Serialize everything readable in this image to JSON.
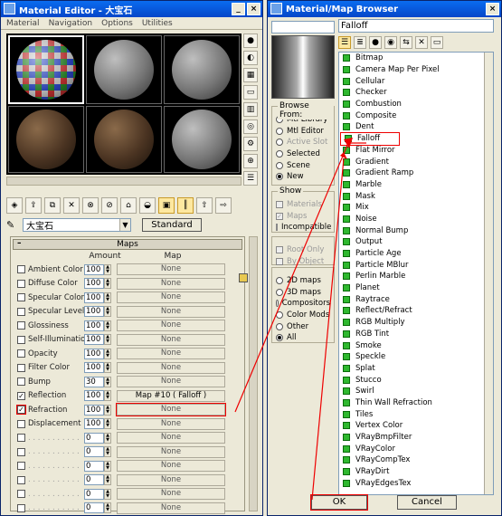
{
  "material_editor": {
    "title": "Material Editor - 大宝石",
    "menu": [
      "Material",
      "Navigation",
      "Options",
      "Utilities"
    ],
    "material_name": "大宝石",
    "type_button": "Standard",
    "rollout_title": "Maps",
    "col_amount": "Amount",
    "col_map": "Map",
    "maps": [
      {
        "label": "Ambient Color",
        "amount": "100",
        "map": "None",
        "checked": false
      },
      {
        "label": "Diffuse Color",
        "amount": "100",
        "map": "None",
        "checked": false
      },
      {
        "label": "Specular Color",
        "amount": "100",
        "map": "None",
        "checked": false
      },
      {
        "label": "Specular Level",
        "amount": "100",
        "map": "None",
        "checked": false
      },
      {
        "label": "Glossiness",
        "amount": "100",
        "map": "None",
        "checked": false
      },
      {
        "label": "Self-Illumination",
        "amount": "100",
        "map": "None",
        "checked": false
      },
      {
        "label": "Opacity",
        "amount": "100",
        "map": "None",
        "checked": false
      },
      {
        "label": "Filter Color",
        "amount": "100",
        "map": "None",
        "checked": false
      },
      {
        "label": "Bump",
        "amount": "30",
        "map": "None",
        "checked": false
      },
      {
        "label": "Reflection",
        "amount": "100",
        "map": "Map #10  ( Falloff )",
        "checked": true
      },
      {
        "label": "Refraction",
        "amount": "100",
        "map": "None",
        "checked": true
      },
      {
        "label": "Displacement",
        "amount": "100",
        "map": "None",
        "checked": false
      },
      {
        "label": "",
        "amount": "0",
        "map": "None",
        "checked": false
      },
      {
        "label": "",
        "amount": "0",
        "map": "None",
        "checked": false
      },
      {
        "label": "",
        "amount": "0",
        "map": "None",
        "checked": false
      },
      {
        "label": "",
        "amount": "0",
        "map": "None",
        "checked": false
      },
      {
        "label": "",
        "amount": "0",
        "map": "None",
        "checked": false
      },
      {
        "label": "",
        "amount": "0",
        "map": "None",
        "checked": false
      }
    ]
  },
  "browser": {
    "title": "Material/Map Browser",
    "name_field": "Falloff",
    "browse_from_label": "Browse From:",
    "browse_from": [
      {
        "label": "Mtl Library",
        "on": false,
        "dim": false
      },
      {
        "label": "Mtl Editor",
        "on": false,
        "dim": false
      },
      {
        "label": "Active Slot",
        "on": false,
        "dim": true
      },
      {
        "label": "Selected",
        "on": false,
        "dim": false
      },
      {
        "label": "Scene",
        "on": false,
        "dim": false
      },
      {
        "label": "New",
        "on": true,
        "dim": false
      }
    ],
    "show_label": "Show",
    "show": [
      {
        "label": "Materials",
        "checked": false,
        "dim": true
      },
      {
        "label": "Maps",
        "checked": true,
        "dim": true
      },
      {
        "label": "Incompatible",
        "checked": false,
        "dim": false
      }
    ],
    "show2": [
      {
        "label": "Root Only",
        "dim": true
      },
      {
        "label": "By Object",
        "dim": true
      }
    ],
    "map_types": [
      {
        "label": "2D maps",
        "on": false
      },
      {
        "label": "3D maps",
        "on": false
      },
      {
        "label": "Compositors",
        "on": false
      },
      {
        "label": "Color Mods",
        "on": false
      },
      {
        "label": "Other",
        "on": false
      },
      {
        "label": "All",
        "on": true
      }
    ],
    "list": [
      "Bitmap",
      "Camera Map Per Pixel",
      "Cellular",
      "Checker",
      "Combustion",
      "Composite",
      "Dent",
      "Falloff",
      "Flat Mirror",
      "Gradient",
      "Gradient Ramp",
      "Marble",
      "Mask",
      "Mix",
      "Noise",
      "Normal Bump",
      "Output",
      "Particle Age",
      "Particle MBlur",
      "Perlin Marble",
      "Planet",
      "Raytrace",
      "Reflect/Refract",
      "RGB Multiply",
      "RGB Tint",
      "Smoke",
      "Speckle",
      "Splat",
      "Stucco",
      "Swirl",
      "Thin Wall Refraction",
      "Tiles",
      "Vertex Color",
      "VRayBmpFilter",
      "VRayColor",
      "VRayCompTex",
      "VRayDirt",
      "VRayEdgesTex"
    ],
    "ok": "OK",
    "cancel": "Cancel"
  }
}
